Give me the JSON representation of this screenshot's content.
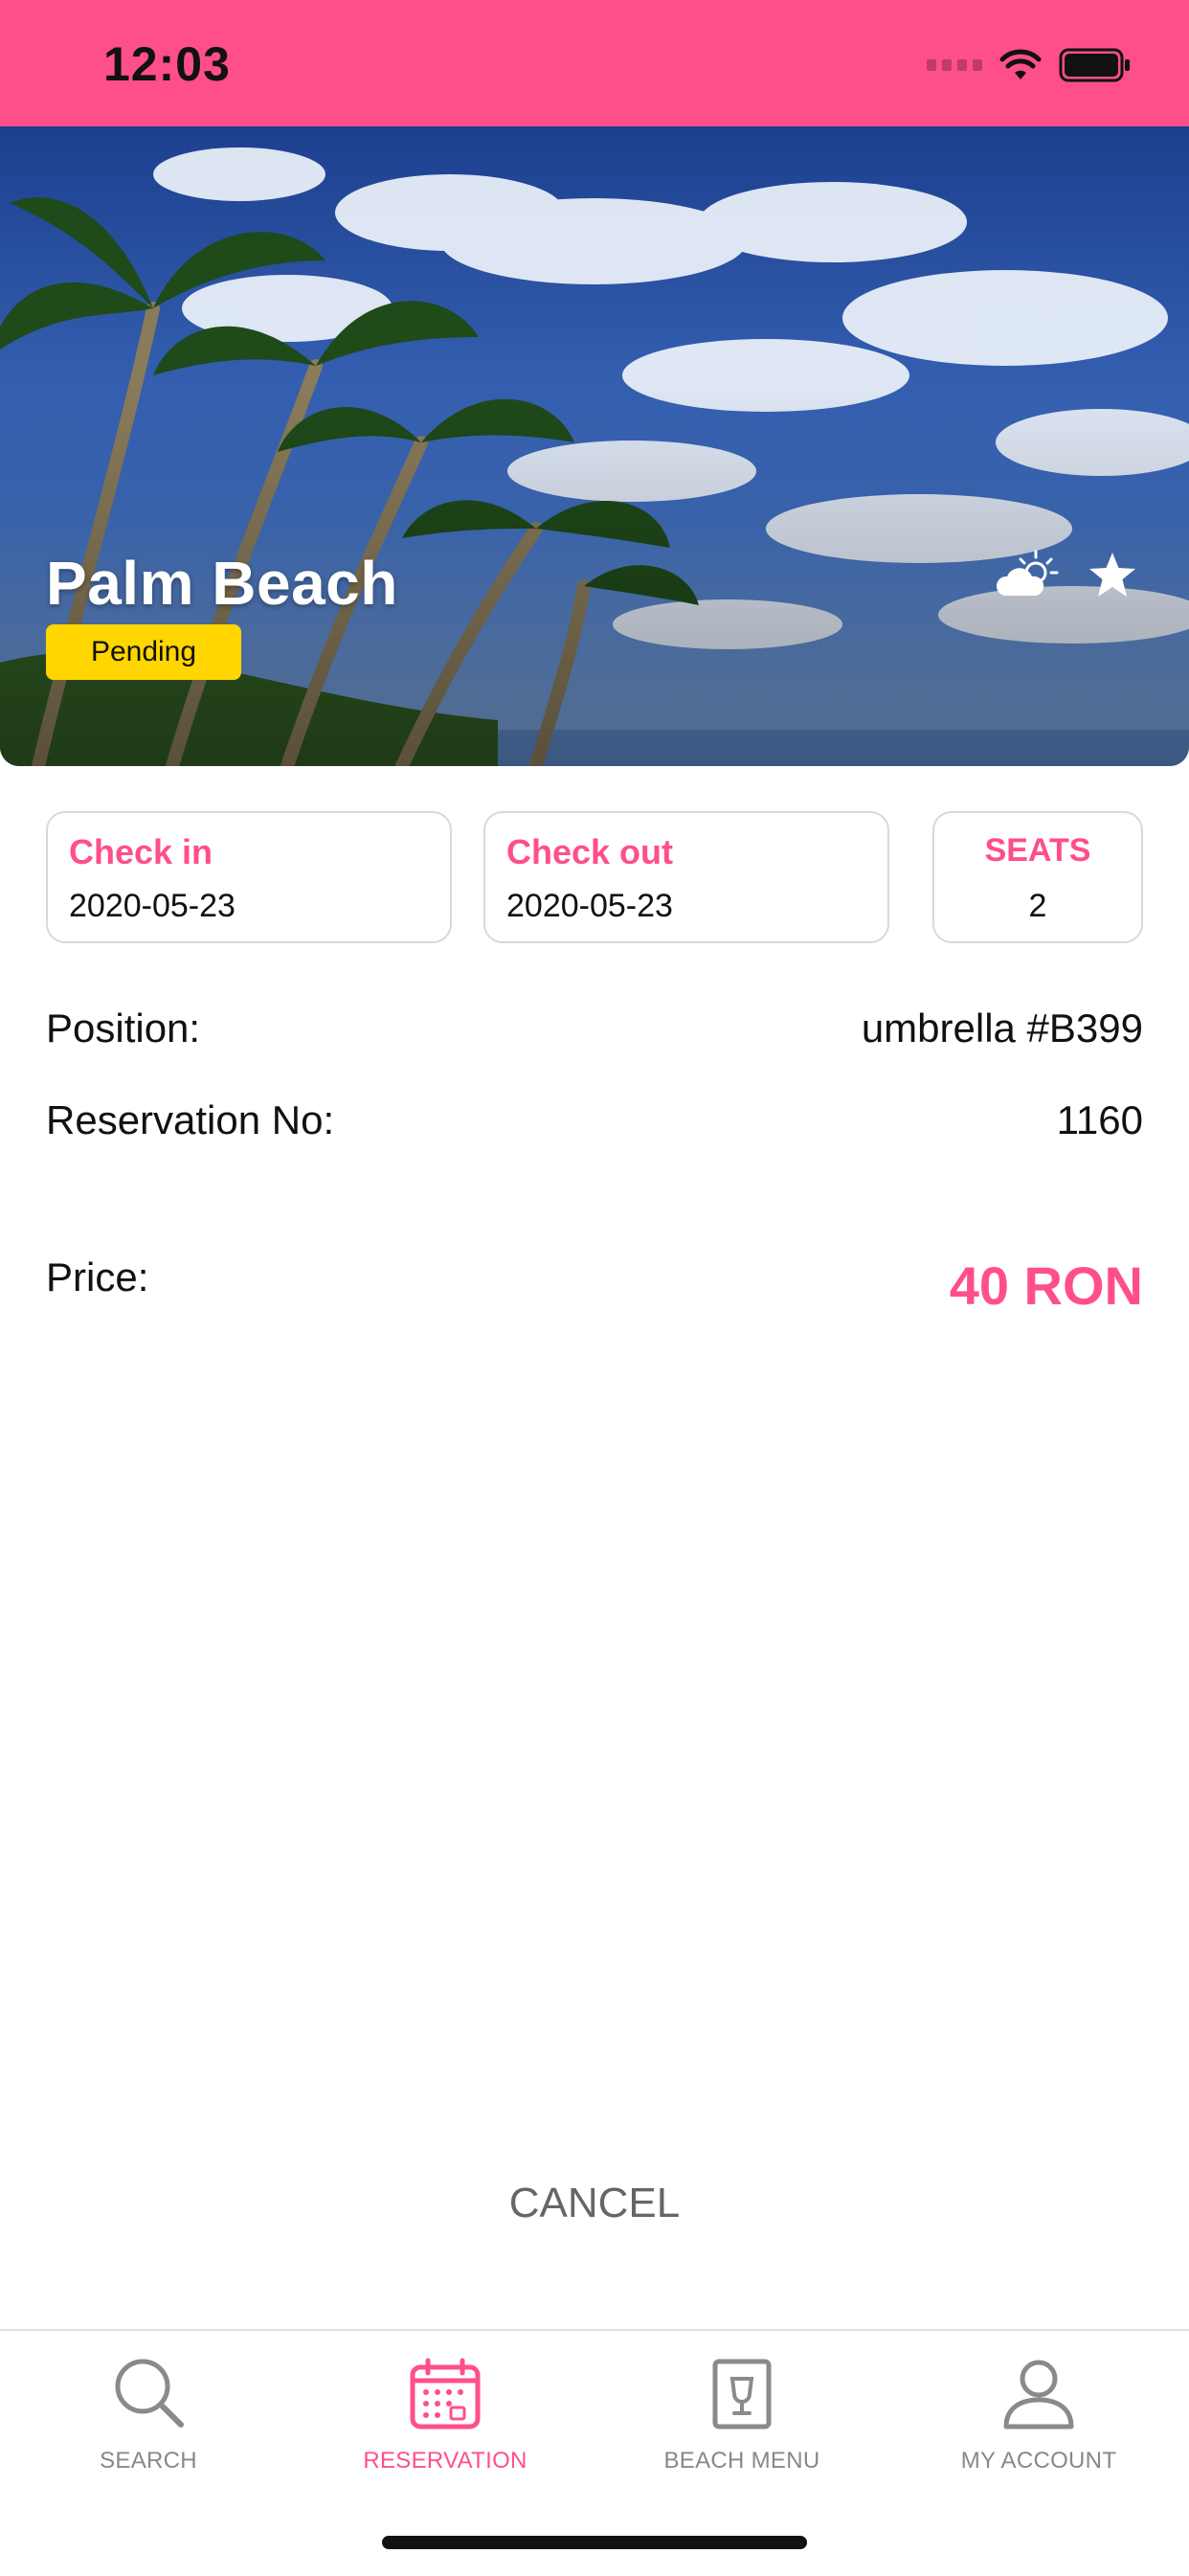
{
  "status_bar": {
    "time": "12:03"
  },
  "hero": {
    "title": "Palm Beach",
    "status": "Pending",
    "icons": [
      "weather-partly-cloudy-icon",
      "star-icon"
    ]
  },
  "dates": {
    "check_in_label": "Check in",
    "check_in_value": "2020-05-23",
    "check_out_label": "Check out",
    "check_out_value": "2020-05-23",
    "seats_label": "SEATS",
    "seats_value": "2"
  },
  "details": {
    "position_label": "Position:",
    "position_value": "umbrella #B399",
    "reservation_label": "Reservation No:",
    "reservation_value": "1160",
    "price_label": "Price:",
    "price_value": "40 RON"
  },
  "actions": {
    "cancel_label": "CANCEL"
  },
  "tab_bar": {
    "items": [
      {
        "label": "SEARCH",
        "icon": "search-icon",
        "active": false
      },
      {
        "label": "RESERVATION",
        "icon": "calendar-icon",
        "active": true
      },
      {
        "label": "BEACH MENU",
        "icon": "menu-book-icon",
        "active": false
      },
      {
        "label": "MY ACCOUNT",
        "icon": "user-icon",
        "active": false
      }
    ]
  },
  "colors": {
    "accent": "#FF4F8B",
    "badge_pending": "#FFD600",
    "muted_text": "#888888"
  }
}
